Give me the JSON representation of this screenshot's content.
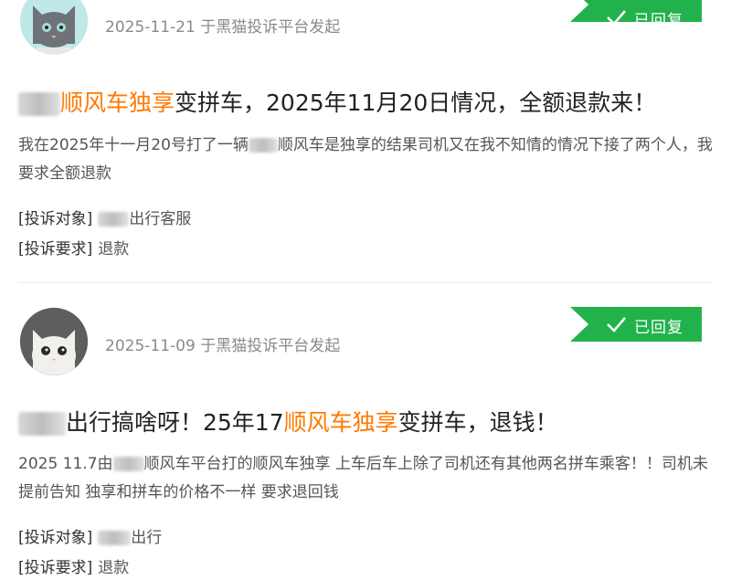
{
  "complaints": [
    {
      "meta": "2025-11-21 于黑猫投诉平台发起",
      "badge": "已回复",
      "title_suffix_1": "顺风车独享",
      "title_suffix_2": "变拼车，2025年11月20日情况，全额退款来！",
      "description": "我在2025年十一月20号打了一辆",
      "description_2": "顺风车是独享的结果司机又在我不知情的情况下接了两个人，我要求全额退款",
      "target_label": "[投诉对象]",
      "target_value": "出行客服",
      "request_label": "[投诉要求]",
      "request_value": "退款"
    },
    {
      "meta": "2025-11-09 于黑猫投诉平台发起",
      "badge": "已回复",
      "title_part_1": "出行搞啥呀！25年17",
      "title_part_2": "顺风车独享",
      "title_part_3": "变拼车，退钱！",
      "description": "2025 11.7由",
      "description_2": "顺风车平台打的顺风车独享 上车后车上除了司机还有其他两名拼车乘客！！司机未提前告知 独享和拼车的价格不一样 要求退回钱",
      "target_label": "[投诉对象]",
      "target_value": "出行",
      "request_label": "[投诉要求]",
      "request_value": "退款"
    }
  ]
}
